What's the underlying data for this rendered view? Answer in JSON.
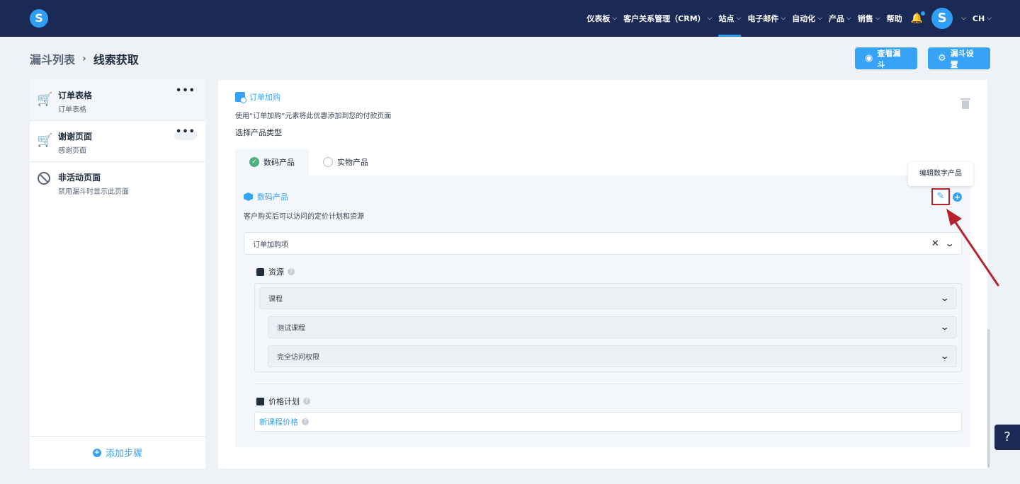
{
  "nav": {
    "logo_letter": "S",
    "items": [
      {
        "label": "仪表板",
        "chev": "⌵"
      },
      {
        "label": "客户关系管理（CRM）",
        "chev": "⌵"
      },
      {
        "label": "站点",
        "chev": "⌵"
      },
      {
        "label": "电子邮件",
        "chev": "⌵"
      },
      {
        "label": "自动化",
        "chev": "⌵"
      },
      {
        "label": "产品",
        "chev": "⌵"
      },
      {
        "label": "销售",
        "chev": "⌵"
      },
      {
        "label": "帮助",
        "chev": ""
      }
    ],
    "active_index": 2,
    "avatar_letter": "S",
    "lang": "CH",
    "lang_chev": "⌵"
  },
  "header": {
    "crumb_parent": "漏斗列表",
    "crumb_sep": "›",
    "crumb_current": "线索获取",
    "view_funnel": "查看漏斗",
    "funnel_settings": "漏斗设置"
  },
  "sidebar": {
    "steps": [
      {
        "title": "订单表格",
        "sub": "订单表格",
        "more": "•••"
      },
      {
        "title": "谢谢页面",
        "sub": "感谢页面",
        "more": "•••"
      },
      {
        "title": "非活动页面",
        "sub": "禁用漏斗时显示此页面"
      }
    ],
    "add_step": "添加步骤",
    "add_plus": "+"
  },
  "editor": {
    "element_title": "订单加购",
    "element_desc": "使用“订单加购”元素将此优惠添加到您的付款页面",
    "select_type_label": "选择产品类型",
    "tabs": [
      {
        "label": "数码产品",
        "check": "✓"
      },
      {
        "label": "实物产品"
      }
    ],
    "product_title": "数码产品",
    "product_desc": "客户购买后可以访问的定价计划和资源",
    "edit_glyph": "✎",
    "add_glyph": "+",
    "tooltip": "编辑数字产品",
    "order_bump_select": "订单加购项",
    "clear_glyph": "✕",
    "chevron_glyph": "⌄",
    "resources_label": "资源",
    "help_glyph": "?",
    "resource_selects": [
      "课程",
      "测试课程",
      "完全访问权限"
    ],
    "price_plan_label": "价格计划",
    "price_input": "新课程价格"
  },
  "help_button": "?",
  "colors": {
    "nav_bg": "#1b2a55",
    "accent": "#36a3f7",
    "success": "#4caf7d",
    "annotation": "#b8232b"
  }
}
